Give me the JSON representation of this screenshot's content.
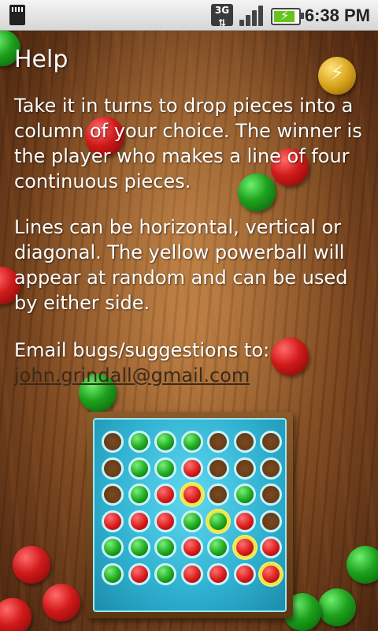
{
  "status_bar": {
    "network": "3G",
    "time": "6:38 PM",
    "icons": [
      "sd-card-icon",
      "network-3g-icon",
      "signal-icon",
      "battery-charging-icon"
    ]
  },
  "help": {
    "title": "Help",
    "paragraph1": "Take it in turns to drop pieces into a column of your choice. The winner is the player who makes a line of four continuous pieces.",
    "paragraph2": "Lines can be horizontal, vertical or diagonal. The yellow powerball will appear at random and can be used by either side.",
    "email_label": "Email bugs/suggestions to:",
    "email": "john.grindall@gmail.com"
  },
  "powerball_icon": "lightning-bolt-icon",
  "colors": {
    "red_piece": "#d11a1a",
    "green_piece": "#1da11d",
    "board": "#2fb0d0",
    "powerball": "#d9a41c"
  },
  "board": {
    "rows": [
      [
        "empty",
        "green",
        "green",
        "green",
        "empty",
        "empty",
        "empty"
      ],
      [
        "empty",
        "green",
        "green",
        "red",
        "empty",
        "empty",
        "empty"
      ],
      [
        "empty",
        "green",
        "red",
        "red-powerball",
        "empty",
        "green",
        "empty"
      ],
      [
        "red",
        "red",
        "red",
        "green",
        "green-powerball",
        "red",
        "empty"
      ],
      [
        "green",
        "green",
        "green",
        "red",
        "green",
        "red-powerball",
        "red"
      ],
      [
        "green",
        "red",
        "green",
        "red",
        "red",
        "red",
        "red-powerball"
      ]
    ]
  }
}
